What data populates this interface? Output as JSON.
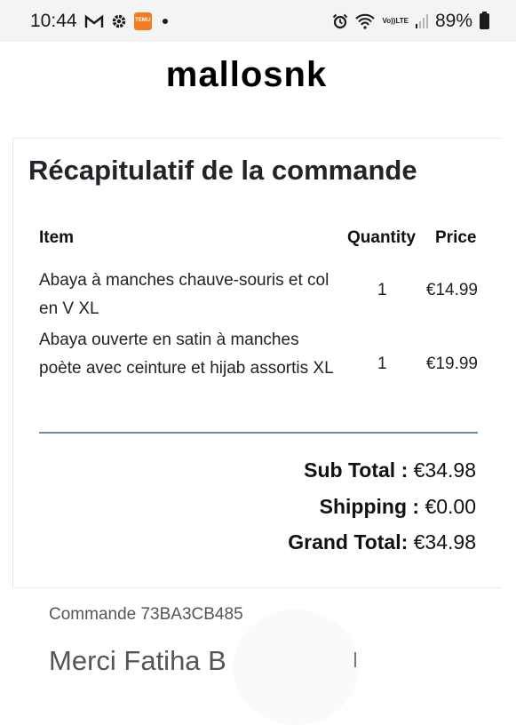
{
  "status_bar": {
    "time": "10:44",
    "temu_label": "TEMU",
    "network": "LTE",
    "volte": "Vo))",
    "battery": "89%"
  },
  "brand": {
    "name": "mallosnk"
  },
  "summary": {
    "title": "Récapitulatif de la commande",
    "headers": {
      "item": "Item",
      "quantity": "Quantity",
      "price": "Price"
    },
    "items": [
      {
        "name": "Abaya à manches chauve-souris et col en V XL",
        "quantity": "1",
        "price": "€14.99"
      },
      {
        "name": "Abaya ouverte en satin à manches poète avec ceinture et hijab assortis XL",
        "quantity": "1",
        "price": "€19.99"
      }
    ],
    "totals": {
      "subtotal_label": "Sub Total :",
      "subtotal_value": "€34.98",
      "shipping_label": "Shipping :",
      "shipping_value": "€0.00",
      "grand_label": "Grand Total:",
      "grand_value": "€34.98"
    }
  },
  "footer": {
    "order_line": "Commande 73BA3CB485",
    "thanks": "Merci Fatiha B"
  }
}
